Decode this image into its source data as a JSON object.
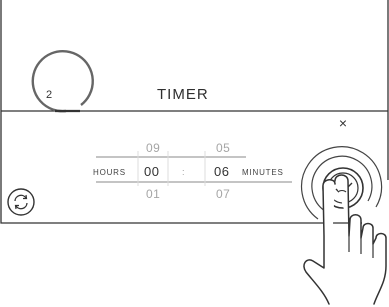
{
  "timer_screen": {
    "title": "TIMER",
    "current_step": "2",
    "picker": {
      "hours": {
        "prev": "09",
        "value": "00",
        "next": "01",
        "unit": "HOURS"
      },
      "separator": ":",
      "minutes": {
        "prev": "05",
        "value": "06",
        "next": "07",
        "unit": "MINUTES"
      }
    },
    "icons": {
      "close": "close-icon",
      "reset": "reset-icon",
      "confirm": "checkmark-icon",
      "hand": "pointing-hand-icon"
    },
    "close_glyph": "×"
  }
}
